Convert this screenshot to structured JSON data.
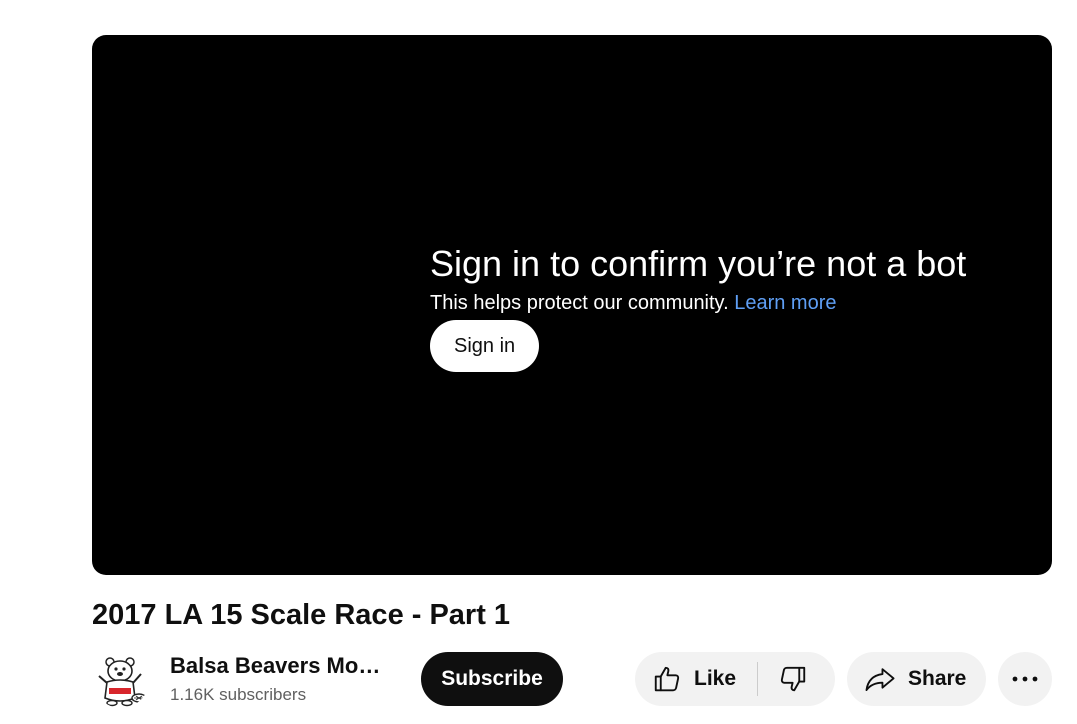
{
  "player": {
    "bot_check": {
      "title": "Sign in to confirm you’re not a bot",
      "subtitle": "This helps protect our community.",
      "learn_more": "Learn more",
      "sign_in_label": "Sign in"
    }
  },
  "video": {
    "title": "2017 LA 15 Scale Race - Part 1"
  },
  "channel": {
    "name": "Balsa Beavers Model Club",
    "subscribers": "1.16K subscribers",
    "avatar_icon": "beaver-mascot-icon"
  },
  "actions": {
    "subscribe_label": "Subscribe",
    "like_label": "Like",
    "share_label": "Share",
    "icons": [
      "thumbs-up-icon",
      "thumbs-down-icon",
      "share-arrow-icon",
      "more-horizontal-icon"
    ]
  },
  "colors": {
    "player_bg": "#000000",
    "link": "#5f9ff5",
    "subscribe_bg": "#0f0f0f",
    "chip_bg": "#f2f2f2",
    "secondary_text": "#606060"
  }
}
